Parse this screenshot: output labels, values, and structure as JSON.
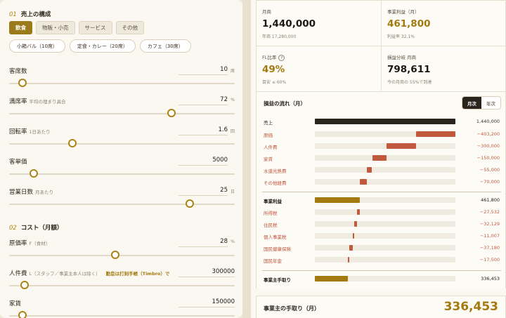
{
  "left": {
    "section1": {
      "num": "01",
      "title": "売上の構成"
    },
    "tabs": [
      {
        "label": "飲食",
        "active": true
      },
      {
        "label": "物販・小売",
        "active": false
      },
      {
        "label": "サービス",
        "active": false
      },
      {
        "label": "その他",
        "active": false
      }
    ],
    "presets": [
      "小箱バル（10席）",
      "定食・カレー（20席）",
      "カフェ（30席）"
    ],
    "fields": [
      {
        "id": "seats",
        "label": "客席数",
        "sub": "",
        "value": "10",
        "unit": "席",
        "level": 0.06
      },
      {
        "id": "fill",
        "label": "満席率",
        "sub": "平均の埋まり具合",
        "value": "72",
        "unit": "%",
        "level": 0.72
      },
      {
        "id": "turn",
        "label": "回転率",
        "sub": "1日あたり",
        "value": "1.6",
        "unit": "回",
        "level": 0.28
      },
      {
        "id": "price",
        "label": "客単価",
        "sub": "",
        "value": "5000",
        "unit": "",
        "level": 0.11
      },
      {
        "id": "days",
        "label": "営業日数",
        "sub": "月あたり",
        "value": "25",
        "unit": "日",
        "level": 0.8
      }
    ],
    "section2": {
      "num": "02",
      "title": "コスト（月額）"
    },
    "cost_fields": [
      {
        "id": "cogs",
        "label": "原価率",
        "sub": "F（食材）",
        "value": "28",
        "unit": "%",
        "level": 0.47,
        "note": ""
      },
      {
        "id": "labor",
        "label": "人件費",
        "sub": "L（スタッフ／事業主本人は除く）",
        "value": "300000",
        "unit": "",
        "level": 0.07,
        "note": "勤怠は打刻手帳（Timbro）で"
      },
      {
        "id": "rent",
        "label": "家賃",
        "sub": "",
        "value": "150000",
        "unit": "",
        "level": 0.06,
        "note": ""
      }
    ]
  },
  "cards": {
    "revenue": {
      "label": "月商",
      "value": "1,440,000",
      "sub": "年商 17,280,000"
    },
    "profit": {
      "label": "事業利益（月）",
      "value": "461,800",
      "sub": "利益率 32.1%"
    },
    "fl": {
      "label": "FL比率",
      "value": "49%",
      "sub": "目安 ≤ 60%",
      "help": "?"
    },
    "breakeven": {
      "label": "損益分岐 月商",
      "value": "798,611",
      "sub": "今の月商の 55%で到達"
    }
  },
  "flow": {
    "title": "損益の流れ（月）",
    "toggle": [
      "月次",
      "年次"
    ],
    "rows": [
      {
        "label": "売上",
        "value": "1,440,000",
        "kind": "revenue",
        "start": 0,
        "amount": 1440000
      },
      {
        "label": "原価",
        "value": "−403,200",
        "kind": "expense",
        "start": 1036800,
        "amount": 403200
      },
      {
        "label": "人件費",
        "value": "−300,000",
        "kind": "expense",
        "start": 736800,
        "amount": 300000
      },
      {
        "label": "家賃",
        "value": "−150,000",
        "kind": "expense",
        "start": 586800,
        "amount": 150000
      },
      {
        "label": "水道光熱費",
        "value": "−55,000",
        "kind": "expense",
        "start": 531800,
        "amount": 55000
      },
      {
        "label": "その他経費",
        "value": "−70,000",
        "kind": "expense",
        "start": 461800,
        "amount": 70000
      },
      {
        "label": "事業利益",
        "value": "461,800",
        "kind": "total",
        "start": 0,
        "amount": 461800
      },
      {
        "label": "所得税",
        "value": "−27,532",
        "kind": "expense",
        "start": 434268,
        "amount": 27532
      },
      {
        "label": "住民税",
        "value": "−32,129",
        "kind": "expense",
        "start": 402139,
        "amount": 32129
      },
      {
        "label": "個人事業税",
        "value": "−11,007",
        "kind": "expense",
        "start": 391132,
        "amount": 11007
      },
      {
        "label": "国民健康保険",
        "value": "−37,180",
        "kind": "expense",
        "start": 353952,
        "amount": 37180
      },
      {
        "label": "国民年金",
        "value": "−17,500",
        "kind": "expense",
        "start": 336452,
        "amount": 17500
      },
      {
        "label": "事業主手取り",
        "value": "336,453",
        "kind": "total",
        "start": 0,
        "amount": 336453
      }
    ],
    "max": 1440000
  },
  "bottom": {
    "label": "事業主の手取り（月）",
    "value": "336,453"
  },
  "colors": {
    "gold": "#a37a10",
    "expense": "#c0593e",
    "dark": "#2b241c"
  }
}
